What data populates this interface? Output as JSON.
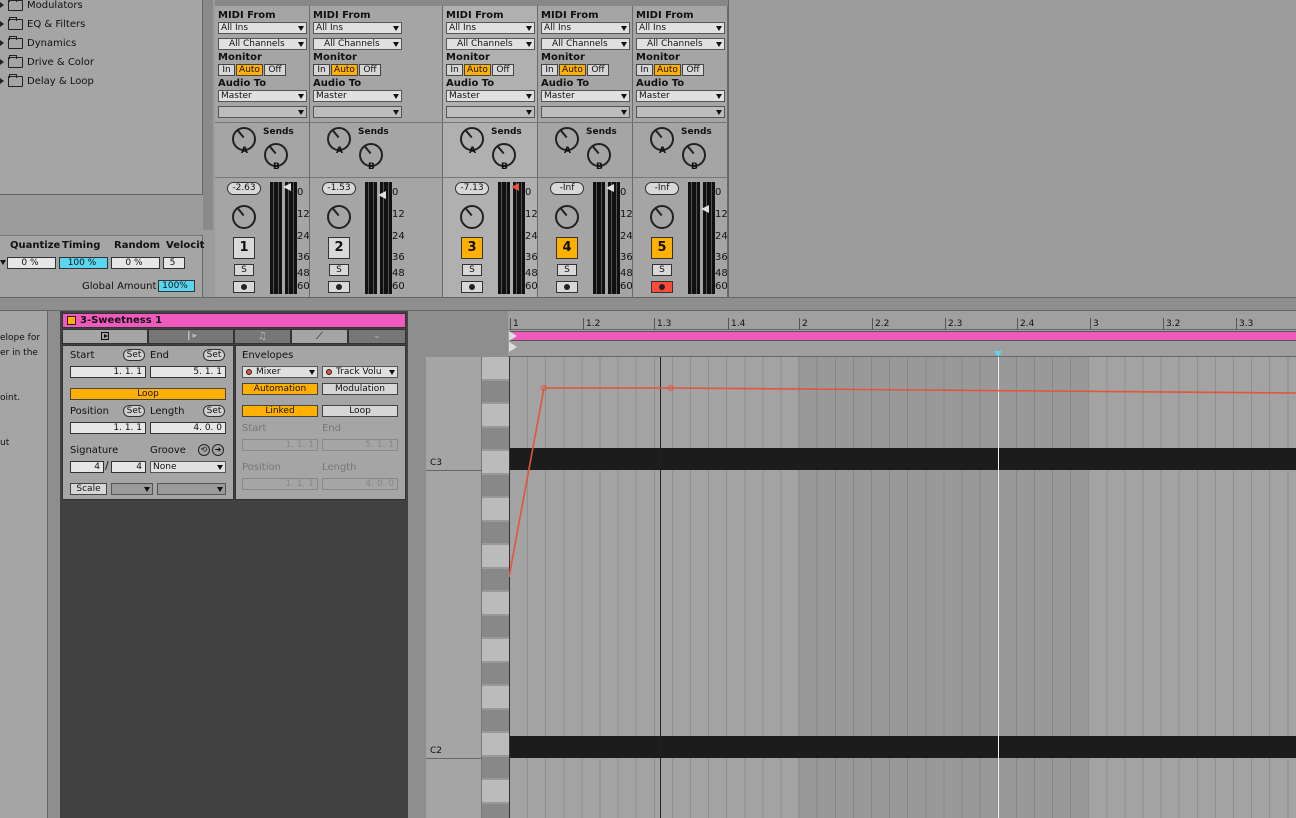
{
  "browser": {
    "items": [
      {
        "label": "Modulators"
      },
      {
        "label": "EQ & Filters"
      },
      {
        "label": "Dynamics"
      },
      {
        "label": "Drive & Color"
      },
      {
        "label": "Delay & Loop"
      }
    ]
  },
  "groove": {
    "headers": [
      "Quantize",
      "Timing",
      "Random",
      "Velocit"
    ],
    "values": [
      "0 %",
      "100 %",
      "0 %",
      "5"
    ],
    "global_label": "Global Amount",
    "global_value": "100%"
  },
  "info": {
    "lines": [
      "elope for",
      "er in the",
      "",
      "oint.",
      "",
      "ut"
    ]
  },
  "mixer": {
    "labels": {
      "midi_from": "MIDI From",
      "monitor": "Monitor",
      "audio_to": "Audio To",
      "sends": "Sends",
      "in": "In",
      "auto": "Auto",
      "off": "Off",
      "knob_a": "A",
      "knob_b": "B",
      "solo": "S"
    },
    "scale": [
      "0",
      "12",
      "24",
      "36",
      "48",
      "60"
    ],
    "tracks": [
      {
        "input": "All Ins",
        "channel": "All Channels",
        "output": "Master",
        "volume": "-2.63",
        "number": "1",
        "active": false,
        "armed": false
      },
      {
        "input": "All Ins",
        "channel": "All Channels",
        "output": "Master",
        "volume": "-1.53",
        "number": "2",
        "active": false,
        "armed": false
      },
      {
        "input": "All Ins",
        "channel": "All Channels",
        "output": "Master",
        "volume": "-7.13",
        "number": "3",
        "active": true,
        "armed": false
      },
      {
        "input": "All Ins",
        "channel": "All Channels",
        "output": "Master",
        "volume": "-Inf",
        "number": "4",
        "active": true,
        "armed": false
      },
      {
        "input": "All Ins",
        "channel": "All Channels",
        "output": "Master",
        "volume": "-Inf",
        "number": "5",
        "active": true,
        "armed": true
      }
    ]
  },
  "clip": {
    "title": "3-Sweetness 1",
    "start_label": "Start",
    "end_label": "End",
    "set": "Set",
    "start": "1.   1.   1",
    "end": "5.   1.   1",
    "loop": "Loop",
    "position_label": "Position",
    "length_label": "Length",
    "position": "1.   1.   1",
    "length": "4.   0.   0",
    "signature_label": "Signature",
    "groove_label": "Groove",
    "sig_num": "4",
    "sig_den": "4",
    "groove": "None",
    "scale": "Scale"
  },
  "envelopes": {
    "title": "Envelopes",
    "device": "Mixer",
    "param": "Track Volu",
    "automation": "Automation",
    "modulation": "Modulation",
    "linked": "Linked",
    "loop": "Loop",
    "start_label": "Start",
    "end_label": "End",
    "start": "1.   1.   1",
    "end": "5.   1.   1",
    "position_label": "Position",
    "length_label": "Length",
    "position": "1.   1.   1",
    "length": "4.   0.   0"
  },
  "ruler": {
    "labels": [
      "1",
      "1.2",
      "1.3",
      "1.4",
      "2",
      "2.2",
      "2.3",
      "2.4",
      "3",
      "3.2",
      "3.3"
    ]
  },
  "piano": {
    "c3": "C3",
    "c2": "C2"
  },
  "colors": {
    "clip": "#f05abf",
    "accent": "#ffb000",
    "automation": "#e5533d",
    "cyan": "#5ad6f0"
  }
}
